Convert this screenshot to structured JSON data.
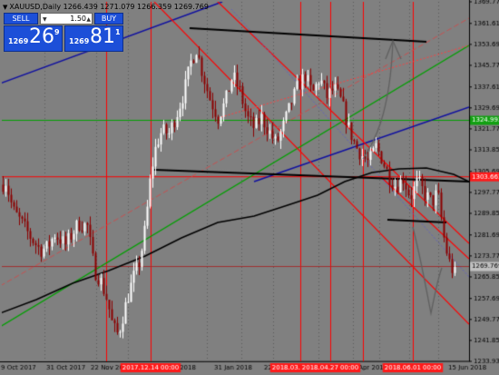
{
  "chart_title": "XAUUSD,Daily  1266.439 1271.079 1266.359 1269.769",
  "trade_panel": {
    "sell_label": "SELL",
    "buy_label": "BUY",
    "lot": "1.50",
    "sell_small": "1269",
    "sell_big": "26",
    "sell_sup": "9",
    "buy_small": "1269",
    "buy_big": "81",
    "buy_sup": "1"
  },
  "price_axis": {
    "labels": [
      "1369.770",
      "1361.610",
      "1353.690",
      "1345.770",
      "1337.610",
      "1329.690",
      "1321.770",
      "1313.850",
      "1305.690",
      "1297.770",
      "1289.850",
      "1281.690",
      "1273.770",
      "1265.850",
      "1257.690",
      "1249.770",
      "1241.850",
      "1233.930"
    ],
    "tags": [
      {
        "text": "1324.993",
        "color": "#12a012"
      },
      {
        "text": "1303.663",
        "color": "#ff1a1a"
      },
      {
        "text": "1269.769",
        "color": "#c0c0c0"
      }
    ]
  },
  "time_axis": {
    "labels": [
      "9 Oct 2017",
      "31 Oct 2017",
      "22 Nov 2017",
      "11 Jan 2018",
      "31 Jan 2018",
      "22 Feb 2018",
      "26 Apr 2018",
      "15 Jun 2018"
    ],
    "highlighted": [
      "2017.12.14 00:00",
      "2018.03.26 00:00",
      "2018.04.27 00:00",
      "2018.06.01 00:00"
    ]
  },
  "colors": {
    "background": "#808080",
    "bull": "#ffffff",
    "bear": "#8b0000",
    "red_line": "#ff0000",
    "green_line": "#00a000",
    "blue_line": "#0000a0",
    "ma_line": "#000000"
  },
  "chart_data": {
    "type": "candlestick",
    "symbol": "XAUUSD",
    "timeframe": "Daily",
    "last": {
      "open": 1266.439,
      "high": 1271.079,
      "low": 1266.359,
      "close": 1269.769
    },
    "ylim": [
      1233.93,
      1369.77
    ],
    "horizontal_levels": [
      1324.993,
      1303.663,
      1269.769
    ],
    "close_path": [
      [
        0,
        1300
      ],
      [
        6,
        1302
      ],
      [
        14,
        1291
      ],
      [
        24,
        1286
      ],
      [
        33,
        1281
      ],
      [
        44,
        1276
      ],
      [
        52,
        1277
      ],
      [
        60,
        1282
      ],
      [
        72,
        1278
      ],
      [
        86,
        1286
      ],
      [
        96,
        1285
      ],
      [
        104,
        1268
      ],
      [
        110,
        1265
      ],
      [
        118,
        1257
      ],
      [
        124,
        1247
      ],
      [
        130,
        1244
      ],
      [
        138,
        1255
      ],
      [
        146,
        1265
      ],
      [
        154,
        1272
      ],
      [
        160,
        1285
      ],
      [
        166,
        1305
      ],
      [
        172,
        1316
      ],
      [
        178,
        1321
      ],
      [
        186,
        1320
      ],
      [
        194,
        1327
      ],
      [
        202,
        1335
      ],
      [
        210,
        1347
      ],
      [
        216,
        1352
      ],
      [
        222,
        1344
      ],
      [
        230,
        1334
      ],
      [
        240,
        1326
      ],
      [
        248,
        1332
      ],
      [
        256,
        1342
      ],
      [
        264,
        1336
      ],
      [
        272,
        1326
      ],
      [
        280,
        1322
      ],
      [
        288,
        1326
      ],
      [
        296,
        1321
      ],
      [
        304,
        1316
      ],
      [
        312,
        1323
      ],
      [
        320,
        1331
      ],
      [
        328,
        1338
      ],
      [
        336,
        1342
      ],
      [
        344,
        1335
      ],
      [
        352,
        1341
      ],
      [
        360,
        1334
      ],
      [
        368,
        1337
      ],
      [
        376,
        1332
      ],
      [
        384,
        1322
      ],
      [
        392,
        1315
      ],
      [
        398,
        1312
      ],
      [
        406,
        1309
      ],
      [
        414,
        1315
      ],
      [
        420,
        1311
      ],
      [
        428,
        1304
      ],
      [
        436,
        1300
      ],
      [
        444,
        1303
      ],
      [
        452,
        1296
      ],
      [
        460,
        1302
      ],
      [
        468,
        1297
      ],
      [
        476,
        1294
      ],
      [
        482,
        1298
      ],
      [
        486,
        1288
      ],
      [
        490,
        1278
      ],
      [
        496,
        1270
      ],
      [
        501,
        1267
      ]
    ]
  }
}
